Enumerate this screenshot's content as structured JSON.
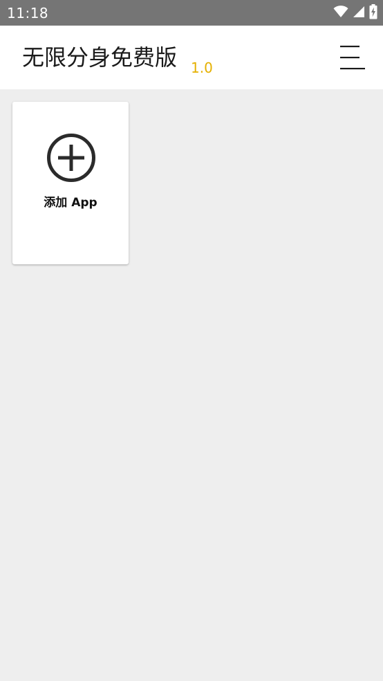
{
  "status_bar": {
    "time": "11:18",
    "icons": [
      "wifi-icon",
      "signal-icon",
      "battery-charging-icon"
    ]
  },
  "app_bar": {
    "title": "无限分身免费版",
    "version": "1.0",
    "menu_icon": "menu-icon"
  },
  "main": {
    "add_card": {
      "icon": "add-circle-icon",
      "label": "添加 App"
    }
  },
  "colors": {
    "status_bar_bg": "#757575",
    "app_bar_bg": "#ffffff",
    "page_bg": "#eeeeee",
    "version_accent": "#e5b000",
    "icon_dark": "#2b2b2b"
  }
}
